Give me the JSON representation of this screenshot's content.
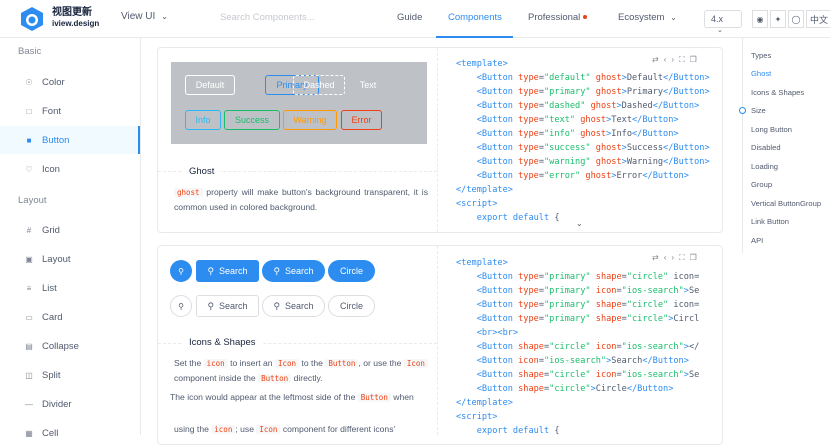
{
  "header": {
    "brand_cn": "视图更新",
    "brand_en": "iview.design",
    "version_select": "View UI",
    "search_placeholder": "Search Components...",
    "nav": [
      "Guide",
      "Components",
      "Professional",
      "Ecosystem"
    ],
    "active_nav": "Components",
    "version": "4.x",
    "lang": "中文"
  },
  "sidebar": {
    "group_basic": "Basic",
    "basic_items": [
      {
        "label": "Color",
        "icon": "palette-icon"
      },
      {
        "label": "Font",
        "icon": "font-icon"
      },
      {
        "label": "Button",
        "icon": "button-icon"
      },
      {
        "label": "Icon",
        "icon": "heart-icon"
      }
    ],
    "group_layout": "Layout",
    "layout_items": [
      {
        "label": "Grid",
        "icon": "grid-icon"
      },
      {
        "label": "Layout",
        "icon": "layout-icon"
      },
      {
        "label": "List",
        "icon": "list-icon"
      },
      {
        "label": "Card",
        "icon": "card-icon"
      },
      {
        "label": "Collapse",
        "icon": "collapse-icon"
      },
      {
        "label": "Split",
        "icon": "split-icon"
      },
      {
        "label": "Divider",
        "icon": "divider-icon"
      },
      {
        "label": "Cell",
        "icon": "cell-icon"
      }
    ],
    "active_item": "Button"
  },
  "ghost_demo": {
    "buttons_row1": [
      "Default",
      "Primary",
      "Dashed",
      "Text"
    ],
    "buttons_row2": [
      "Info",
      "Success",
      "Warning",
      "Error"
    ],
    "title": "Ghost",
    "desc_chip": "ghost",
    "desc_text": " property will make button's background transparent, it is common used in colored background."
  },
  "ghost_code": [
    "<template>",
    "    <Button type=\"default\" ghost>Default</Button>",
    "    <Button type=\"primary\" ghost>Primary</Button>",
    "    <Button type=\"dashed\" ghost>Dashed</Button>",
    "    <Button type=\"text\" ghost>Text</Button>",
    "    <Button type=\"info\" ghost>Info</Button>",
    "    <Button type=\"success\" ghost>Success</Button>",
    "    <Button type=\"warning\" ghost>Warning</Button>",
    "    <Button type=\"error\" ghost>Error</Button>",
    "</template>",
    "<script>",
    "    export default {"
  ],
  "icons_demo": {
    "search_label": "Search",
    "circle_label": "Circle",
    "title": "Icons & Shapes",
    "p1_a": "Set the ",
    "p1_chip1": "icon",
    "p1_b": " to insert an ",
    "p1_chip2": "Icon",
    "p1_c": " to the ",
    "p1_chip3": "Button",
    "p1_d": ", or use the ",
    "p1_chip4": "Icon",
    "p1_e": " component inside the ",
    "p1_chip5": "Button",
    "p1_f": " directly.",
    "p2_a": "The icon would appear at the leftmost side of the ",
    "p2_chip": "Button",
    "p2_b": " when",
    "p3_a": "using the ",
    "p3_chip1": "icon",
    "p3_b": "; use ",
    "p3_chip2": "Icon",
    "p3_c": " component for different icons'"
  },
  "icons_code": [
    "<template>",
    "    <Button type=\"primary\" shape=\"circle\" icon=",
    "    <Button type=\"primary\" icon=\"ios-search\">Se",
    "    <Button type=\"primary\" shape=\"circle\" icon=",
    "    <Button type=\"primary\" shape=\"circle\">Circl",
    "    <br><br>",
    "    <Button shape=\"circle\" icon=\"ios-search\"></",
    "    <Button icon=\"ios-search\">Search</Button>",
    "    <Button shape=\"circle\" icon=\"ios-search\">Se",
    "    <Button shape=\"circle\">Circle</Button>",
    "</template>",
    "<script>",
    "    export default {"
  ],
  "toc": [
    "Types",
    "Ghost",
    "Icons & Shapes",
    "Size",
    "Long Button",
    "Disabled",
    "Loading",
    "Group",
    "Vertical ButtonGroup",
    "Link Button",
    "API"
  ],
  "toc_active": "Ghost",
  "colors": {
    "primary": "#2d8cf0",
    "info": "#2db7f5",
    "success": "#19be6b",
    "warning": "#ff9900",
    "error": "#ed4014"
  }
}
